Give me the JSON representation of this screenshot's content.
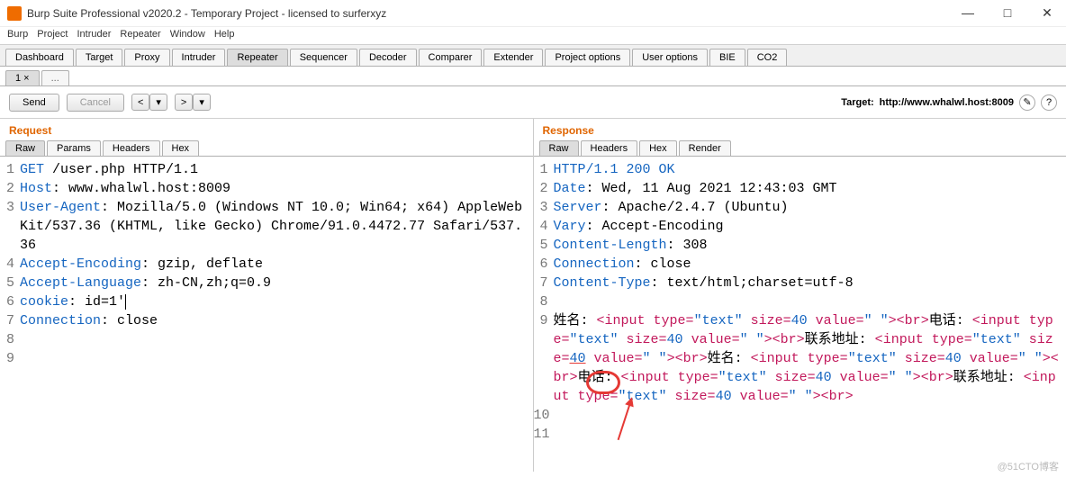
{
  "window": {
    "title": "Burp Suite Professional v2020.2 - Temporary Project - licensed to surferxyz",
    "min": "—",
    "max": "□",
    "close": "✕"
  },
  "menu": [
    "Burp",
    "Project",
    "Intruder",
    "Repeater",
    "Window",
    "Help"
  ],
  "maintabs": [
    "Dashboard",
    "Target",
    "Proxy",
    "Intruder",
    "Repeater",
    "Sequencer",
    "Decoder",
    "Comparer",
    "Extender",
    "Project options",
    "User options",
    "BIE",
    "CO2"
  ],
  "maintab_active": 4,
  "subtabs": [
    "1 ×",
    "..."
  ],
  "subtab_active": 0,
  "toolbar": {
    "send": "Send",
    "cancel": "Cancel",
    "prev": "<",
    "prev_drop": "▾",
    "next": ">",
    "next_drop": "▾",
    "target_label": "Target:",
    "target_value": "http://www.whalwl.host:8009",
    "edit": "✎",
    "help": "?"
  },
  "request": {
    "title": "Request",
    "tabs": [
      "Raw",
      "Params",
      "Headers",
      "Hex"
    ],
    "active": 0,
    "lines": [
      {
        "n": "1",
        "pre": "GET",
        "rest": " /user.php HTTP/1.1"
      },
      {
        "n": "2",
        "key": "Host",
        "val": ": www.whalwl.host:8009"
      },
      {
        "n": "3",
        "key": "User-Agent",
        "val": ": Mozilla/5.0 (Windows NT 10.0; Win64; x64) AppleWebKit/537.36 (KHTML, like Gecko) Chrome/91.0.4472.77 Safari/537.36"
      },
      {
        "n": "4",
        "key": "Accept-Encoding",
        "val": ": gzip, deflate"
      },
      {
        "n": "5",
        "key": "Accept-Language",
        "val": ": zh-CN,zh;q=0.9"
      },
      {
        "n": "6",
        "key": "cookie",
        "val": ": id=1'"
      },
      {
        "n": "7",
        "key": "Connection",
        "val": ": close"
      },
      {
        "n": "8",
        "raw": ""
      },
      {
        "n": "9",
        "raw": ""
      }
    ]
  },
  "response": {
    "title": "Response",
    "tabs": [
      "Raw",
      "Headers",
      "Hex",
      "Render"
    ],
    "active": 0,
    "lines": [
      {
        "n": "1",
        "raw": "HTTP/1.1 200 OK"
      },
      {
        "n": "2",
        "key": "Date",
        "val": ": Wed, 11 Aug 2021 12:43:03 GMT"
      },
      {
        "n": "3",
        "key": "Server",
        "val": ": Apache/2.4.7 (Ubuntu)"
      },
      {
        "n": "4",
        "key": "Vary",
        "val": ": Accept-Encoding"
      },
      {
        "n": "5",
        "key": "Content-Length",
        "val": ": 308"
      },
      {
        "n": "6",
        "key": "Connection",
        "val": ": close"
      },
      {
        "n": "7",
        "key": "Content-Type",
        "val": ": text/html;charset=utf-8"
      },
      {
        "n": "8",
        "raw": ""
      }
    ],
    "body": {
      "n": "9",
      "label1": "姓名: ",
      "label2": "电话: ",
      "label3": "联系地址: ",
      "label4": "姓名: ",
      "label5": "电话: ",
      "label6": "联系地址: ",
      "lt": "<",
      "gt": ">",
      "tag_input": "input",
      "tag_br": "br",
      "attr_type": " type=",
      "attr_size": " size=",
      "attr_value": " value=",
      "v_text": "\"text\"",
      "v_40_a": "40",
      "v_40_b": "40",
      "v_sp": "\" \""
    },
    "tail": [
      {
        "n": "10",
        "raw": ""
      },
      {
        "n": "11",
        "raw": ""
      }
    ]
  },
  "watermark": "@51CTO博客"
}
